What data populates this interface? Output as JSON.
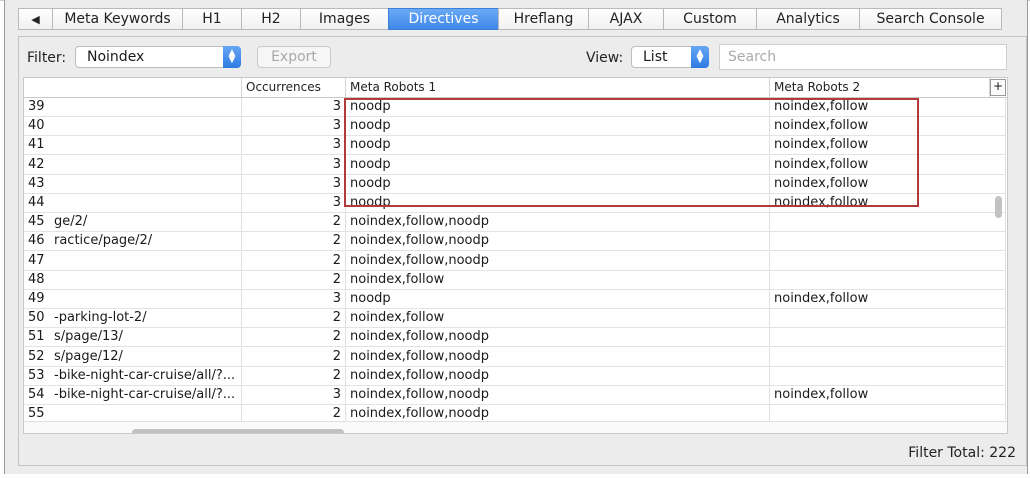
{
  "tabs": [
    {
      "label": "◀",
      "active": false,
      "width": 34
    },
    {
      "label": "Meta Keywords",
      "active": false,
      "width": 130
    },
    {
      "label": "H1",
      "active": false,
      "width": 59
    },
    {
      "label": "H2",
      "active": false,
      "width": 59
    },
    {
      "label": "Images",
      "active": false,
      "width": 88
    },
    {
      "label": "Directives",
      "active": true,
      "width": 110
    },
    {
      "label": "Hreflang",
      "active": false,
      "width": 90
    },
    {
      "label": "AJAX",
      "active": false,
      "width": 75
    },
    {
      "label": "Custom",
      "active": false,
      "width": 93
    },
    {
      "label": "Analytics",
      "active": false,
      "width": 103
    },
    {
      "label": "Search Console",
      "active": false,
      "width": 143
    }
  ],
  "filterbar": {
    "filter_label": "Filter:",
    "filter_value": "Noindex",
    "export_label": "Export",
    "view_label": "View:",
    "view_value": "List",
    "search_placeholder": "Search"
  },
  "table": {
    "columns": [
      "",
      "Occurrences",
      "Meta Robots 1",
      "Meta Robots 2"
    ],
    "rows": [
      {
        "num": "39",
        "address": "",
        "occ": "3",
        "m1": "noodp",
        "m2": "noindex,follow"
      },
      {
        "num": "40",
        "address": "",
        "occ": "3",
        "m1": "noodp",
        "m2": "noindex,follow"
      },
      {
        "num": "41",
        "address": "",
        "occ": "3",
        "m1": "noodp",
        "m2": "noindex,follow"
      },
      {
        "num": "42",
        "address": "",
        "occ": "3",
        "m1": "noodp",
        "m2": "noindex,follow"
      },
      {
        "num": "43",
        "address": "",
        "occ": "3",
        "m1": "noodp",
        "m2": "noindex,follow"
      },
      {
        "num": "44",
        "address": "",
        "occ": "3",
        "m1": "noodp",
        "m2": "noindex,follow"
      },
      {
        "num": "45",
        "address": "ge/2/",
        "occ": "2",
        "m1": "noindex,follow,noodp",
        "m2": ""
      },
      {
        "num": "46",
        "address": "ractice/page/2/",
        "occ": "2",
        "m1": "noindex,follow,noodp",
        "m2": ""
      },
      {
        "num": "47",
        "address": "",
        "occ": "2",
        "m1": "noindex,follow,noodp",
        "m2": ""
      },
      {
        "num": "48",
        "address": "",
        "occ": "2",
        "m1": "noindex,follow",
        "m2": ""
      },
      {
        "num": "49",
        "address": "",
        "occ": "3",
        "m1": "noodp",
        "m2": "noindex,follow"
      },
      {
        "num": "50",
        "address": "-parking-lot-2/",
        "occ": "2",
        "m1": "noindex,follow",
        "m2": ""
      },
      {
        "num": "51",
        "address": "s/page/13/",
        "occ": "2",
        "m1": "noindex,follow,noodp",
        "m2": ""
      },
      {
        "num": "52",
        "address": "s/page/12/",
        "occ": "2",
        "m1": "noindex,follow,noodp",
        "m2": ""
      },
      {
        "num": "53",
        "address": "-bike-night-car-cruise/all/?...",
        "occ": "2",
        "m1": "noindex,follow,noodp",
        "m2": ""
      },
      {
        "num": "54",
        "address": "-bike-night-car-cruise/all/?...",
        "occ": "3",
        "m1": "noindex,follow,noodp",
        "m2": "noindex,follow"
      },
      {
        "num": "55",
        "address": "",
        "occ": "2",
        "m1": "noindex,follow,noodp",
        "m2": ""
      }
    ]
  },
  "footer": {
    "filter_total_label": "Filter Total:",
    "filter_total_value": "222"
  }
}
